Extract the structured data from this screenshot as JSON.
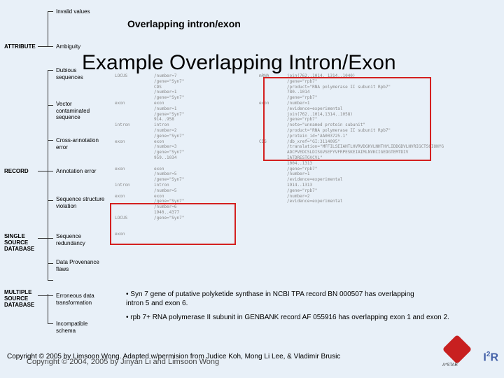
{
  "sidebar": {
    "labels": {
      "attribute": "ATTRIBUTE",
      "record": "RECORD",
      "single": "SINGLE SOURCE DATABASE",
      "multiple": "MULTIPLE SOURCE DATABASE"
    },
    "items": [
      "Invalid values",
      "Ambiguity",
      "Dubious sequences",
      "Vector contaminated sequence",
      "Cross-annotation error",
      "Annotation error",
      "Sequence structure violation",
      "Sequence redundancy",
      "Data Provenance flaws",
      "Erroneous data transformation",
      "Incompatible schema"
    ]
  },
  "header": {
    "sub": "Overlapping intron/exon"
  },
  "title": "Example Overlapping Intron/Exon",
  "bullets": [
    "• Syn 7 gene of putative polyketide synthase in NCBI TPA record BN 000507 has overlapping intron 5 and exon 6.",
    "• rpb 7+ RNA polymerase II subunit in GENBANK record AF 055916 has overlapping exon 1 and exon 2."
  ],
  "copyright": "Copyright © 2005 by Limsoon Wong. Adapted w/permision from Judice Koh, Mong Li Lee, & Vladimir Brusic",
  "copyright2": "Copyright © 2004, 2005 by Jinyan Li and Limsoon Wong",
  "records": {
    "col1": [
      "LOCUS",
      "",
      "",
      "",
      "",
      "exon",
      "",
      "",
      "",
      "intron",
      "",
      "",
      "exon",
      "",
      "",
      "",
      "",
      "exon",
      "",
      "",
      "intron",
      "",
      "exon",
      "",
      "",
      "",
      "LOCUS",
      "",
      "",
      "exon"
    ],
    "col2": [
      "/number=7",
      "/gene=\"Syn7\"",
      "CDS",
      "/number=1",
      "/gene=\"Syn7\"",
      "exon",
      "/number=1",
      "/gene=\"Syn7\"",
      "914..958",
      "intron",
      "/number=2",
      "/gene=\"Syn7\"",
      "exon",
      "/number=3",
      "/gene=\"Syn7\"",
      "959..1034",
      "",
      "exon",
      "/number=5",
      "/gene=\"Syn7\"",
      "intron",
      "/number=5",
      "exon",
      "/gene=\"Syn7\"",
      "/number=6",
      "1940..4377",
      "/gene=\"Syn7\""
    ],
    "col3": [
      "mRNA",
      "",
      "",
      "",
      "",
      "exon",
      "",
      "",
      "",
      "",
      "",
      "",
      "CDS"
    ],
    "col4": [
      "join(762..1014, 1314..1040)",
      "/gene=\"rpb7\"",
      "/product=\"RNA polymerase II subunit Rpb7\"",
      "780..1014",
      "/gene=\"rpb7\"",
      "/number=1",
      "/evidence=experimental",
      "join(762..1014,1314..1058)",
      "/gene=\"rpb7\"",
      "/note=\"unnamed protein subunit\"",
      "/product=\"RNA polymerase II subunit Rpb7\"",
      "/protein_id=\"AA003725.1\"",
      "/db_xref=\"GI:3114095\"",
      "/translation=\"MFFILSEIAHTLHVRVDGKVLNHTHYLIDDGDVLNVRIGCTSCIONYG",
      "ADCPVEDCSLDISGVSEFYVFRPESKEIAIMLNVKCIGEDGTEMTDIV",
      "IATDRESTGVCVL\"",
      "1004..1313",
      "/gene=\"rpb7\"",
      "/number=1",
      "/evidence=experimental",
      "1914..1313",
      "/gene=\"rpb7\"",
      "/number=2",
      "/evidence=experimental"
    ]
  },
  "logo": {
    "astar": "A*STAR",
    "i2r_i": "I",
    "i2r_2": "2",
    "i2r_r": "R"
  }
}
